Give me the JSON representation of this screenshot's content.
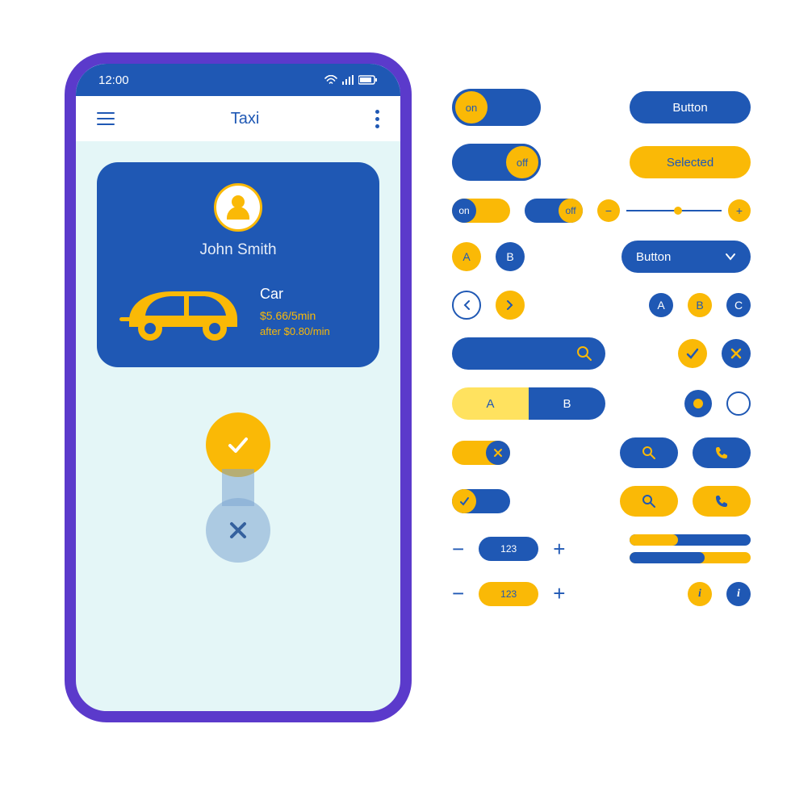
{
  "status": {
    "time": "12:00"
  },
  "app": {
    "title": "Taxi"
  },
  "driver": {
    "name": "John Smith",
    "vehicle_label": "Car",
    "price_line1": "$5.66/5min",
    "price_line2": "after $0.80/min"
  },
  "ui_kit": {
    "button_default": "Button",
    "button_selected": "Selected",
    "toggle_on": "on",
    "toggle_off": "off",
    "letter_a": "A",
    "letter_b": "B",
    "letter_c": "C",
    "dropdown_label": "Button",
    "segment_a": "A",
    "segment_b": "B",
    "stepper_value": "123",
    "info_label": "i",
    "plus": "+",
    "minus": "−"
  },
  "colors": {
    "blue": "#1f58b4",
    "yellow": "#fab906",
    "purple": "#5b3acb"
  }
}
